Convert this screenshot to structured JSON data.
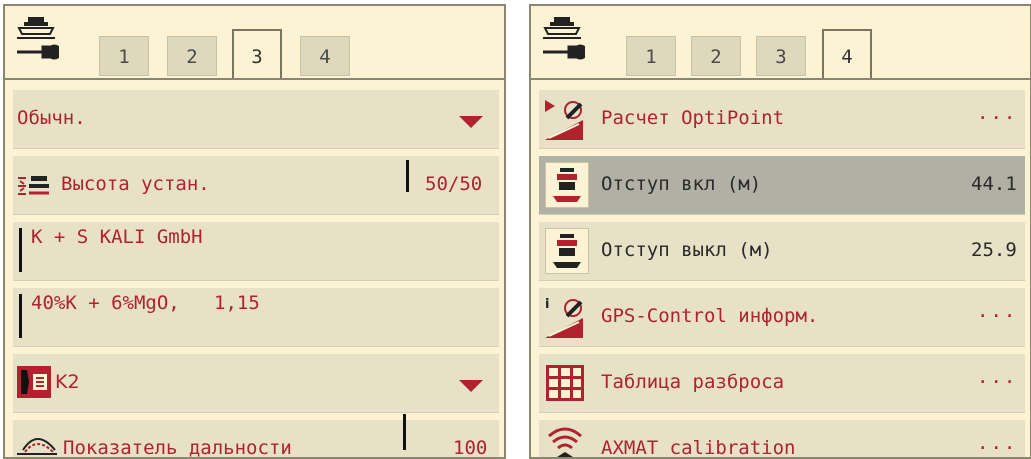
{
  "colors": {
    "accent": "#b0222e",
    "panel_bg": "#fcf3d4",
    "row_bg": "#e7e1c7",
    "selected_row_bg": "#b1b0a4"
  },
  "left_panel": {
    "home_icon": "machine-settings-icon",
    "tabs": [
      {
        "label": "1",
        "active": false
      },
      {
        "label": "2",
        "active": false
      },
      {
        "label": "3",
        "active": true
      },
      {
        "label": "4",
        "active": false
      }
    ],
    "rows": {
      "mode": {
        "label": "Обычн."
      },
      "height": {
        "label": "Высота устан.",
        "value": "50/50",
        "icon": "spreader-height-icon"
      },
      "manufacturer": {
        "value": "K + S KALI GmbH"
      },
      "fertilizer": {
        "value": "40%K + 6%MgO,   1,15"
      },
      "vane": {
        "label": "K2",
        "icon": "spreading-vane-icon"
      },
      "range": {
        "label": "Показатель дальности",
        "value": "100",
        "icon": "spread-range-icon"
      }
    }
  },
  "right_panel": {
    "home_icon": "machine-settings-icon",
    "tabs": [
      {
        "label": "1",
        "active": false
      },
      {
        "label": "2",
        "active": false
      },
      {
        "label": "3",
        "active": false
      },
      {
        "label": "4",
        "active": true
      }
    ],
    "rows": {
      "optipoint": {
        "label": "Расчет OptiPoint",
        "value": "···",
        "icon": "optipoint-gps-icon"
      },
      "distance_on": {
        "label": "Отступ вкл (м)",
        "value": "44.1",
        "icon": "distance-on-icon"
      },
      "distance_off": {
        "label": "Отступ выкл (м)",
        "value": "25.9",
        "icon": "distance-off-icon"
      },
      "gps_info": {
        "label": "GPS-Control информ.",
        "value": "···",
        "icon": "gps-info-icon"
      },
      "spread_table": {
        "label": "Таблица разброса",
        "value": "···",
        "icon": "spread-table-icon"
      },
      "axmat": {
        "label": "AXMAT calibration",
        "value": "···",
        "icon": "axmat-calibration-icon"
      }
    }
  }
}
